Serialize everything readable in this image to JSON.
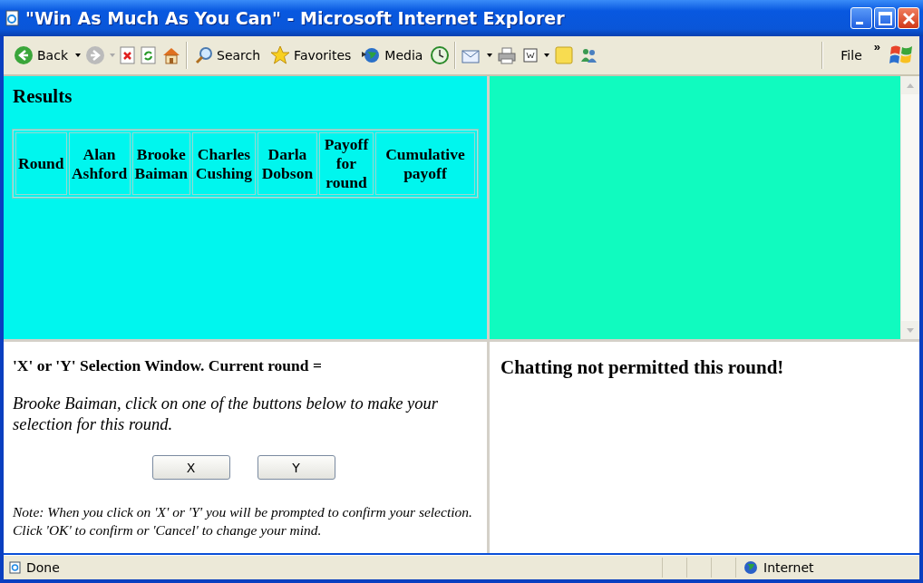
{
  "window": {
    "title": "\"Win As Much As You Can\" - Microsoft Internet Explorer"
  },
  "toolbar": {
    "back": "Back",
    "search": "Search",
    "favorites": "Favorites",
    "media": "Media",
    "menu": "File",
    "chevron": "»"
  },
  "results": {
    "heading": "Results",
    "columns": [
      "Round",
      "Alan Ashford",
      "Brooke Baiman",
      "Charles Cushing",
      "Darla Dobson",
      "Payoff for round",
      "Cumulative payoff"
    ]
  },
  "selection": {
    "heading": "'X' or 'Y' Selection Window. Current round =",
    "instruction": "Brooke Baiman, click on one of the buttons below to make your selection for this round.",
    "buttons": [
      "X",
      "Y"
    ],
    "note": "Note: When you click on 'X' or 'Y' you will be prompted to confirm your selection. Click 'OK' to confirm or 'Cancel' to change your mind."
  },
  "chat": {
    "message": "Chatting not permitted this round!"
  },
  "status_bar": {
    "status": "Done",
    "zone": "Internet"
  }
}
